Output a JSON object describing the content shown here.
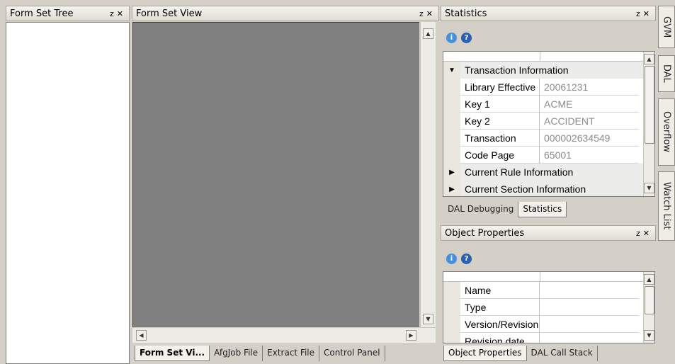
{
  "form_set_tree": {
    "title": "Form Set Tree",
    "pin": "↕",
    "close": "✕"
  },
  "form_set_view": {
    "title": "Form Set View",
    "pin": "↕",
    "close": "✕"
  },
  "statistics": {
    "title": "Statistics",
    "categories": {
      "transaction": "Transaction Information",
      "rule": "Current Rule Information",
      "section": "Current Section Information"
    },
    "rows": [
      {
        "name": "Library Effective Date",
        "value": "20061231"
      },
      {
        "name": "Key 1",
        "value": "ACME"
      },
      {
        "name": "Key 2",
        "value": "ACCIDENT"
      },
      {
        "name": "Transaction",
        "value": "000002634549"
      },
      {
        "name": "Code Page",
        "value": "65001"
      }
    ]
  },
  "stats_tabs": {
    "dal_debugging": "DAL Debugging",
    "statistics": "Statistics"
  },
  "object_properties": {
    "title": "Object Properties",
    "rows": [
      {
        "name": "Name",
        "value": ""
      },
      {
        "name": "Type",
        "value": ""
      },
      {
        "name": "Version/Revision",
        "value": ""
      },
      {
        "name": "Revision date",
        "value": ""
      }
    ]
  },
  "center_tabs": [
    "Form Set Vi...",
    "AfgJob File",
    "Extract File",
    "Control Panel"
  ],
  "right_bottom_tabs": [
    "Object Properties",
    "DAL Call Stack"
  ],
  "side_tabs": [
    "GVM",
    "DAL",
    "Overflow",
    "Watch List"
  ],
  "icons": {
    "info": "i",
    "help": "?"
  }
}
